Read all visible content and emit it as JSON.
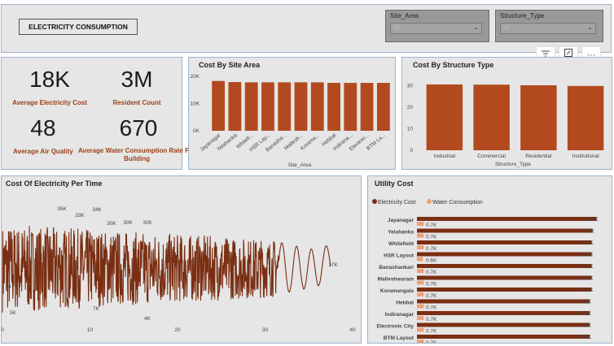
{
  "header": {
    "title": "ELECTRICITY CONSUMPTION"
  },
  "slicers": [
    {
      "label": "Site_Area",
      "value": "All"
    },
    {
      "label": "Structure_Type",
      "value": "All"
    }
  ],
  "toolbar": {
    "filter_icon": "filter-icon",
    "focus_icon": "focus-mode-icon",
    "more_icon": "more-options-icon",
    "more_label": "···"
  },
  "kpis": [
    {
      "value": "18K",
      "label": "Average Electricity Cost"
    },
    {
      "value": "3M",
      "label": "Resident Count"
    },
    {
      "value": "48",
      "label": "Average Air Quality"
    },
    {
      "value": "670",
      "label": "Average Water Consumption Rate Per Building"
    }
  ],
  "colors": {
    "accent": "#b34a1f",
    "line": "#7a2e12",
    "water": "#f0a079",
    "panel": "#e6e6e6"
  },
  "chart_data": [
    {
      "type": "bar",
      "title": "Cost By Site Area",
      "xlabel": "Site_Area",
      "ylabel": "",
      "categories": [
        "Jayanagar",
        "Yelahanka",
        "Whitefi...",
        "HSR Lay...",
        "Banasha...",
        "Mallesh...",
        "Korama...",
        "Hebbal",
        "Indirana...",
        "Electron...",
        "BTM La..."
      ],
      "values": [
        18300,
        17900,
        17800,
        17800,
        17800,
        17800,
        17800,
        17600,
        17600,
        17600,
        17600
      ],
      "yticks": [
        "0K",
        "10K",
        "20K"
      ],
      "ylim": [
        0,
        20000
      ]
    },
    {
      "type": "bar",
      "title": "Cost By Structure Type",
      "xlabel": "Structure_Type",
      "ylabel": "",
      "categories": [
        "Industrial",
        "Commercial",
        "Residential",
        "Institutional"
      ],
      "values": [
        30.5,
        30.4,
        30.1,
        29.8
      ],
      "yticks": [
        "0",
        "10",
        "20",
        "30"
      ],
      "ylim": [
        0,
        35
      ]
    },
    {
      "type": "line",
      "title": "Cost Of Electricity Per Time",
      "xlabel": "",
      "ylabel": "",
      "xticks": [
        "0",
        "10",
        "20",
        "30",
        "40"
      ],
      "xlim": [
        0,
        40
      ],
      "ylim": [
        0,
        40000
      ],
      "annotations": [
        "35K",
        "33K",
        "34K",
        "30K",
        "30K",
        "30K",
        "17K",
        "14",
        "5K",
        "7K",
        "4K"
      ],
      "series": [
        {
          "values_range": [
            4000,
            35000
          ],
          "end_value": 17000
        }
      ]
    },
    {
      "type": "bar",
      "title": "Utility Cost",
      "orientation": "horizontal",
      "legend": [
        "Electricity Cost",
        "Water Consumption"
      ],
      "legend_position": "top-left",
      "categories": [
        "Jayanagar",
        "Yelahanka",
        "Whitefield",
        "HSR Layout",
        "Banashankari",
        "Malleshwaram",
        "Koramangala",
        "Hebbal",
        "Indiranagar",
        "Electronic City",
        "BTM Layout"
      ],
      "series": [
        {
          "name": "Electricity Cost",
          "values": [
            18.3,
            17.9,
            17.8,
            17.8,
            17.8,
            17.8,
            17.8,
            17.6,
            17.6,
            17.6,
            17.6
          ],
          "labels": [
            "18.3K",
            "17.9K",
            "17.8K",
            "17.8K",
            "17.8K",
            "17.8K",
            "17.8K",
            "17.6K",
            "17.6K",
            "17.6K",
            "17.6K"
          ]
        },
        {
          "name": "Water Consumption",
          "values": [
            0.7,
            0.7,
            0.7,
            0.6,
            0.7,
            0.7,
            0.7,
            0.7,
            0.7,
            0.7,
            0.7
          ],
          "labels": [
            "0.7K",
            "0.7K",
            "0.7K",
            "0.6K",
            "0.7K",
            "0.7K",
            "0.7K",
            "0.7K",
            "0.7K",
            "0.7K",
            "0.7K"
          ]
        }
      ],
      "xlim": [
        0,
        18.5
      ]
    }
  ]
}
